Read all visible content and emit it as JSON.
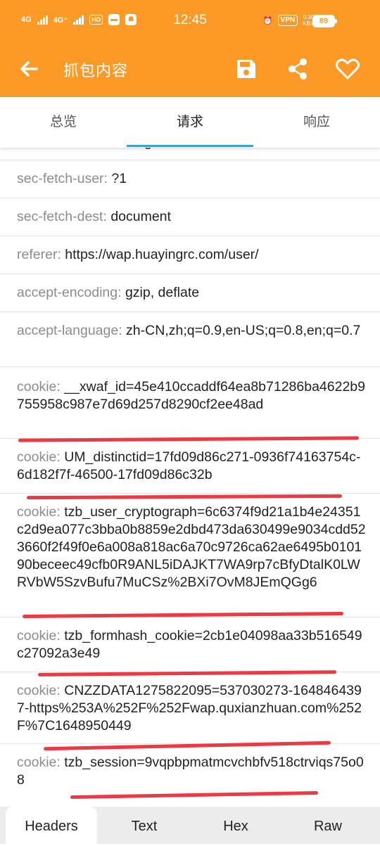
{
  "status_bar": {
    "network1": "4G",
    "network2": "4G⁺",
    "hd_badge": "HD",
    "time": "12:45",
    "vpn": "VPN",
    "speed_value": "0.30",
    "speed_unit": "KB/s",
    "battery": "89"
  },
  "app_bar": {
    "title": "抓包内容"
  },
  "tabs": [
    "总览",
    "请求",
    "响应"
  ],
  "headers": [
    {
      "key": "sec-fetch-mode",
      "sep": ": ",
      "value": "navigate"
    },
    {
      "key": "sec-fetch-user",
      "sep": ": ",
      "value": "?1"
    },
    {
      "key": "sec-fetch-dest",
      "sep": ": ",
      "value": "document"
    },
    {
      "key": "referer",
      "sep": ": ",
      "value": "https://wap.huayingrc.com/user/"
    },
    {
      "key": "accept-encoding",
      "sep": ": ",
      "value": "gzip, deflate"
    },
    {
      "key": "accept-language",
      "sep": ": ",
      "value": "zh-CN,zh;q=0.9,en-US;q=0.8,en;q=0.7"
    },
    {
      "key": "cookie",
      "sep": ": ",
      "value": "__xwaf_id=45e410ccaddf64ea8b71286ba4622b9755958c987e7d69d257d8290cf2ee48ad"
    },
    {
      "key": "cookie",
      "sep": ": ",
      "value": "UM_distinctid=17fd09d86c271-0936f74163754c-6d182f7f-46500-17fd09d86c32b"
    },
    {
      "key": "cookie",
      "sep": ": ",
      "value": "tzb_user_cryptograph=6c6374f9d21a1b4e24351c2d9ea077c3bba0b8859e2dbd473da630499e9034cdd523660f2f49f0e6a008a818ac6a70c9726ca62ae6495b010190beceec49cfb0R9ANL5iDAJKT7WA9rp7cBfyDtalK0LWRVbW5SzvBufu7MuCSz%2BXi7OvM8JEmQGg6"
    },
    {
      "key": "cookie",
      "sep": ": ",
      "value": "tzb_formhash_cookie=2cb1e04098aa33b516549c27092a3e49"
    },
    {
      "key": "cookie",
      "sep": ": ",
      "value": "CNZZDATA1275822095=537030273-1648464397-https%253A%252F%252Fwap.quxianzhuan.com%252F%7C1648950449"
    },
    {
      "key": "cookie",
      "sep": ": ",
      "value": "tzb_session=9vqpbpmatmcvchbfv518ctrviqs75o08"
    }
  ],
  "bottom_tabs": [
    "Headers",
    "Text",
    "Hex",
    "Raw"
  ],
  "colors": {
    "accent": "#fb9a26",
    "tab_indicator": "#3aa0d8",
    "annotation_red": "#ec3a44",
    "key_gray": "#8c8c8c"
  }
}
